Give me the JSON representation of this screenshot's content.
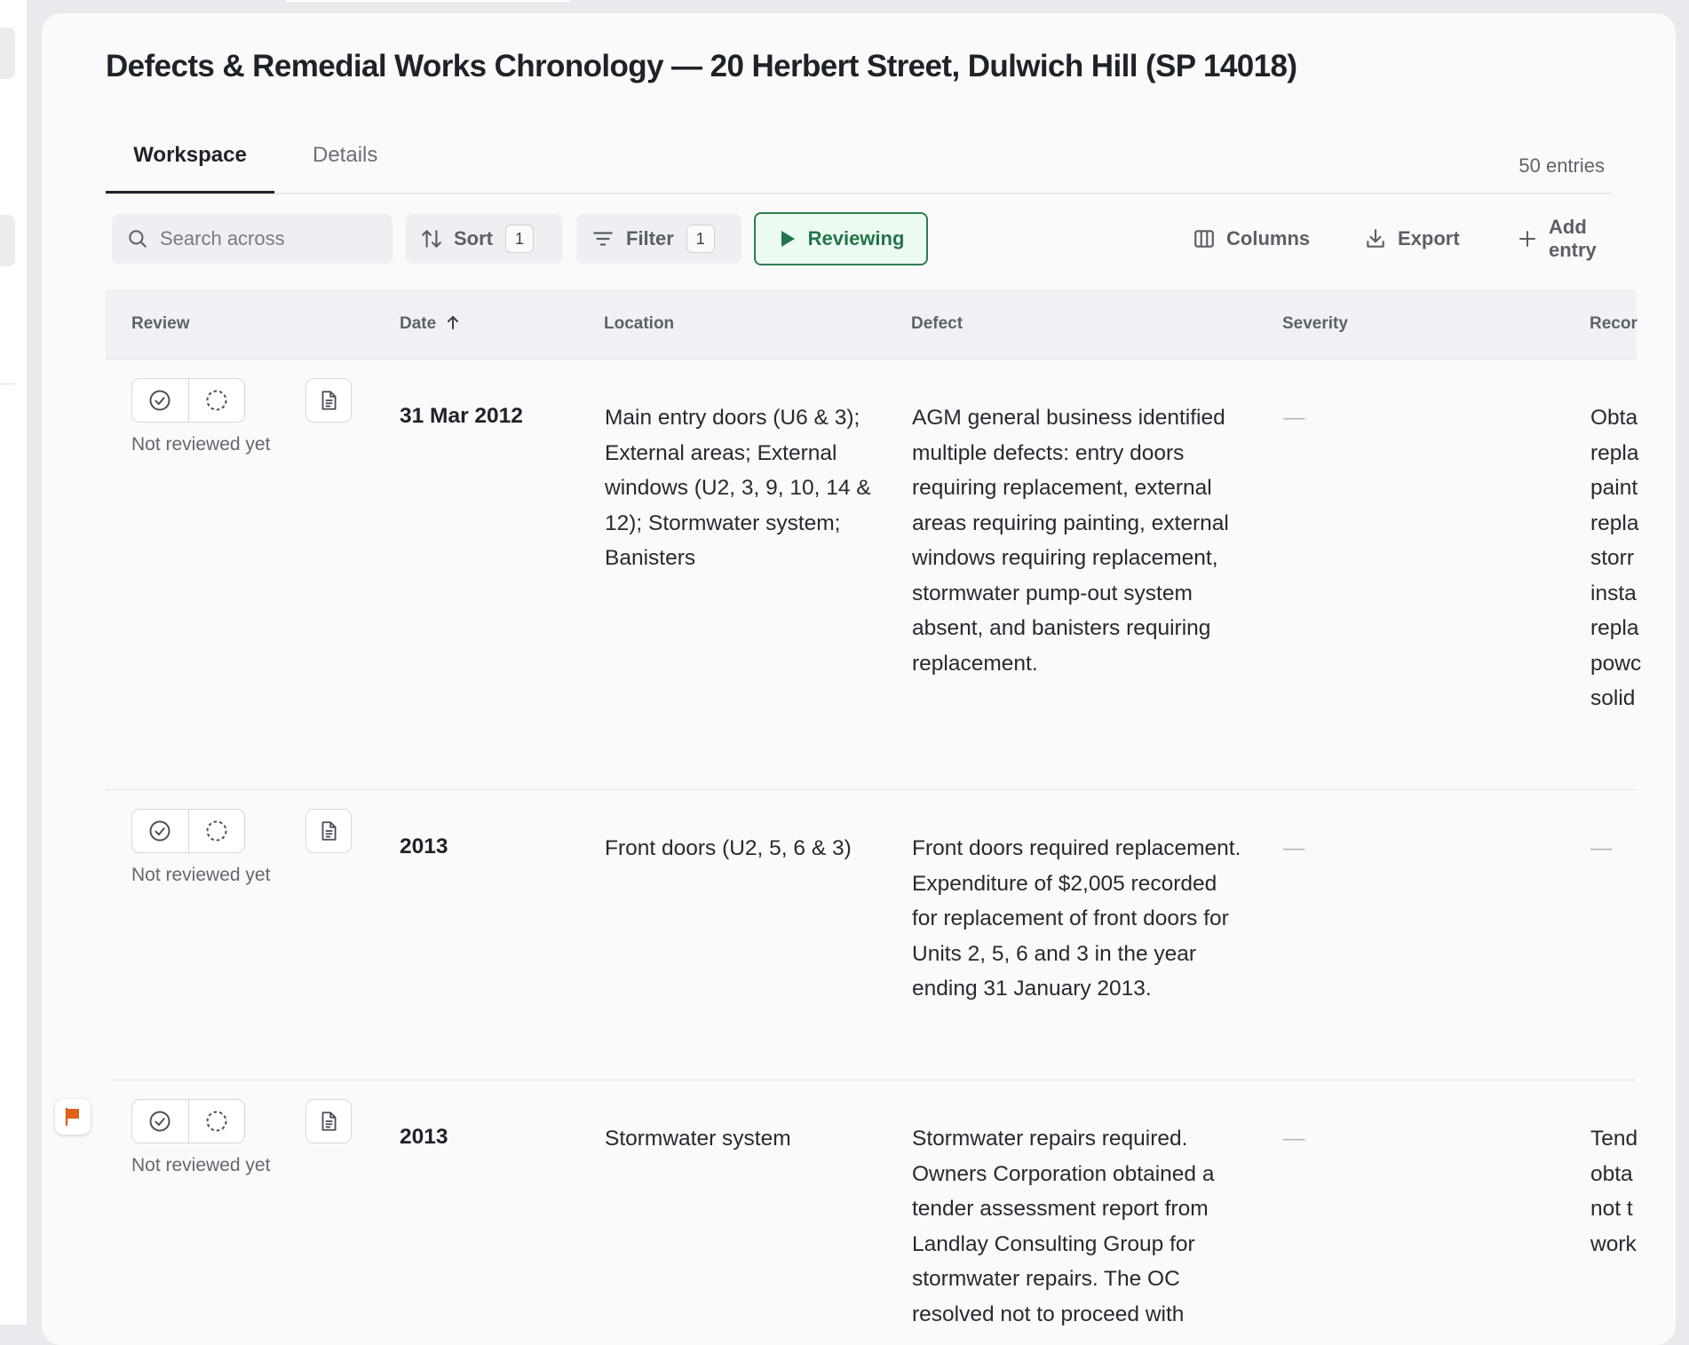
{
  "page": {
    "title": "Defects & Remedial Works Chronology — 20 Herbert Street, Dulwich Hill (SP 14018)"
  },
  "tabs": [
    {
      "label": "Workspace",
      "active": true
    },
    {
      "label": "Details",
      "active": false
    }
  ],
  "entry_count": "50 entries",
  "toolbar": {
    "search_placeholder": "Search across",
    "sort_label": "Sort",
    "sort_count": "1",
    "filter_label": "Filter",
    "filter_count": "1",
    "review_label": "Reviewing",
    "columns_label": "Columns",
    "export_label": "Export",
    "add_label": "Add entry"
  },
  "table": {
    "columns": [
      "Review",
      "Date",
      "Location",
      "Defect",
      "Severity",
      "Recor"
    ],
    "sort_icon": "arrow-up-icon",
    "rows": [
      {
        "review_status": "Not reviewed yet",
        "flagged": false,
        "date": "31 Mar 2012",
        "location": "Main entry doors (U6 & 3); External areas; External windows (U2, 3, 9, 10, 14 & 12); Stormwater system; Banisters",
        "defect": "AGM general business identified multiple defects: entry doors requiring replacement, external areas requiring painting, external windows requiring replacement, stormwater pump-out system absent, and banisters requiring replacement.",
        "severity": "—",
        "recommendation": "Obta\nrepla\npaint\nrepla\nstorr\ninsta\nrepla\npowc\nsolid"
      },
      {
        "review_status": "Not reviewed yet",
        "flagged": false,
        "date": "2013",
        "location": "Front doors (U2, 5, 6 & 3)",
        "defect": "Front doors required replacement. Expenditure of $2,005 recorded for replacement of front doors for Units 2, 5, 6 and 3 in the year ending 31 January 2013.",
        "severity": "—",
        "recommendation": "—"
      },
      {
        "review_status": "Not reviewed yet",
        "flagged": true,
        "date": "2013",
        "location": "Stormwater system",
        "defect": "Stormwater repairs required. Owners Corporation obtained a tender assessment report from Landlay Consulting Group for stormwater repairs. The OC resolved not to proceed with",
        "severity": "—",
        "recommendation": "Tend\nobta\nnot t\nwork"
      }
    ]
  },
  "colors": {
    "accent_green": "#2e7d4f",
    "review_bg": "#ecfbf2",
    "flag_orange": "#e0611a"
  },
  "icons": {
    "search": "search-icon",
    "sort": "sort-icon",
    "filter": "filter-icon",
    "review": "play-icon",
    "columns": "columns-icon",
    "export": "download-icon",
    "add": "plus-icon",
    "approve": "check-circle-icon",
    "pending": "dashed-circle-icon",
    "document": "document-icon",
    "flag": "flag-icon"
  }
}
